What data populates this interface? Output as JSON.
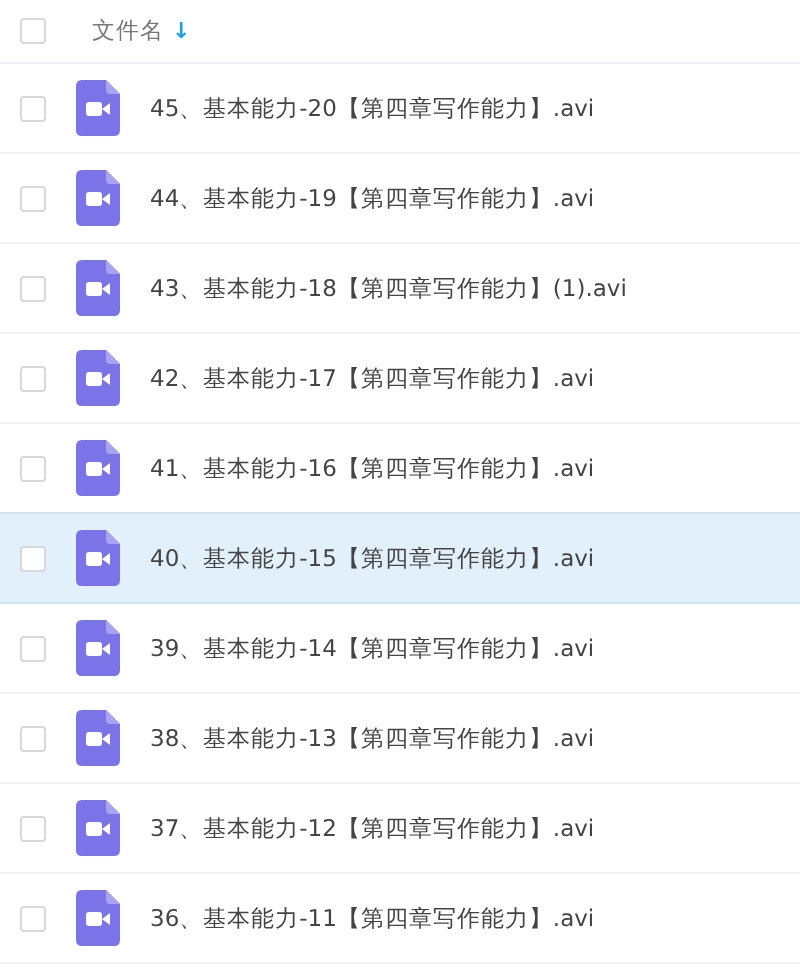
{
  "header": {
    "checked": false,
    "column_label": "文件名",
    "sort_icon": "↓"
  },
  "rows": [
    {
      "name": "45、基本能力-20【第四章写作能力】.avi",
      "selected": false,
      "checked": false
    },
    {
      "name": "44、基本能力-19【第四章写作能力】.avi",
      "selected": false,
      "checked": false
    },
    {
      "name": "43、基本能力-18【第四章写作能力】(1).avi",
      "selected": false,
      "checked": false
    },
    {
      "name": "42、基本能力-17【第四章写作能力】.avi",
      "selected": false,
      "checked": false
    },
    {
      "name": "41、基本能力-16【第四章写作能力】.avi",
      "selected": false,
      "checked": false
    },
    {
      "name": "40、基本能力-15【第四章写作能力】.avi",
      "selected": true,
      "checked": false
    },
    {
      "name": "39、基本能力-14【第四章写作能力】.avi",
      "selected": false,
      "checked": false
    },
    {
      "name": "38、基本能力-13【第四章写作能力】.avi",
      "selected": false,
      "checked": false
    },
    {
      "name": "37、基本能力-12【第四章写作能力】.avi",
      "selected": false,
      "checked": false
    },
    {
      "name": "36、基本能力-11【第四章写作能力】.avi",
      "selected": false,
      "checked": false
    }
  ]
}
